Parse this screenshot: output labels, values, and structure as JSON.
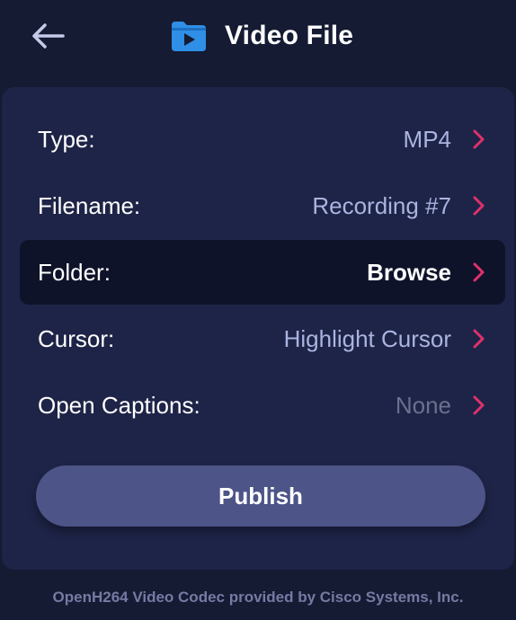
{
  "header": {
    "back_icon": "back-arrow-icon",
    "folder_icon": "video-folder-icon",
    "title": "Video File"
  },
  "rows": [
    {
      "label": "Type:",
      "value": "MP4",
      "icon": "chevron-right-icon"
    },
    {
      "label": "Filename:",
      "value": "Recording #7",
      "icon": "chevron-right-icon"
    },
    {
      "label": "Folder:",
      "value": "Browse",
      "icon": "chevron-right-icon"
    },
    {
      "label": "Cursor:",
      "value": "Highlight Cursor",
      "icon": "chevron-right-icon"
    },
    {
      "label": "Open Captions:",
      "value": "None",
      "icon": "chevron-right-icon"
    }
  ],
  "publish_label": "Publish",
  "footer": "OpenH264 Video Codec provided by Cisco Systems, Inc.",
  "colors": {
    "background": "#151b33",
    "panel": "#1e2447",
    "selected_row": "#0f1329",
    "accent_chevron": "#e0316c",
    "folder_blue": "#2f8fe6",
    "publish_button": "#4d5487",
    "value_text": "#aab4e0",
    "muted_text": "#6b708c"
  }
}
